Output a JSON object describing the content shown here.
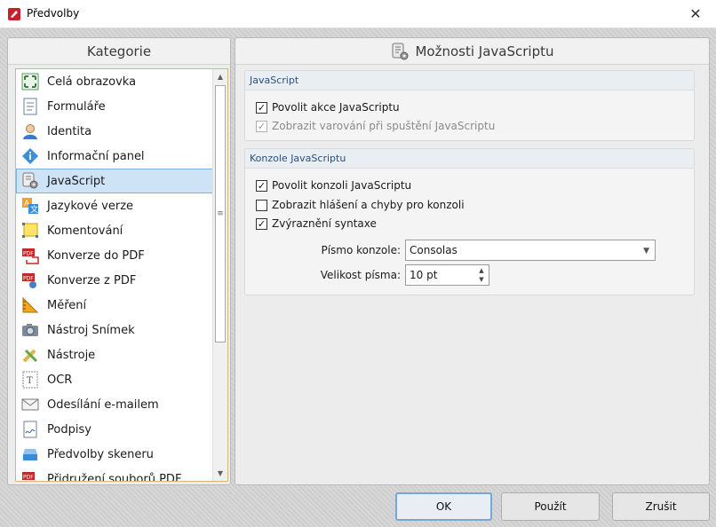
{
  "window": {
    "title": "Předvolby",
    "close_glyph": "✕"
  },
  "left_panel": {
    "header": "Kategorie",
    "items": [
      {
        "label": "Celá obrazovka",
        "icon": "fullscreen-icon"
      },
      {
        "label": "Formuláře",
        "icon": "form-icon"
      },
      {
        "label": "Identita",
        "icon": "person-icon"
      },
      {
        "label": "Informační panel",
        "icon": "info-icon"
      },
      {
        "label": "JavaScript",
        "icon": "script-gear-icon",
        "selected": true
      },
      {
        "label": "Jazykové verze",
        "icon": "language-icon"
      },
      {
        "label": "Komentování",
        "icon": "comment-icon"
      },
      {
        "label": "Konverze do PDF",
        "icon": "pdf-convert-to-icon"
      },
      {
        "label": "Konverze z PDF",
        "icon": "pdf-convert-from-icon"
      },
      {
        "label": "Měření",
        "icon": "ruler-icon"
      },
      {
        "label": "Nástroj Snímek",
        "icon": "camera-icon"
      },
      {
        "label": "Nástroje",
        "icon": "tools-icon"
      },
      {
        "label": "OCR",
        "icon": "ocr-icon"
      },
      {
        "label": "Odesílání e-mailem",
        "icon": "email-icon"
      },
      {
        "label": "Podpisy",
        "icon": "signature-icon"
      },
      {
        "label": "Předvolby skeneru",
        "icon": "scanner-icon"
      },
      {
        "label": "Přidružení souborů PDF",
        "icon": "pdf-association-icon"
      }
    ]
  },
  "right_panel": {
    "header": "Možnosti JavaScriptu",
    "group_javascript": {
      "title": "JavaScript",
      "enable_actions": {
        "label": "Povolit akce JavaScriptu",
        "checked": true
      },
      "show_warning": {
        "label": "Zobrazit varování při spuštění JavaScriptu",
        "checked": true,
        "disabled": true
      }
    },
    "group_console": {
      "title": "Konzole JavaScriptu",
      "enable_console": {
        "label": "Povolit konzoli JavaScriptu",
        "checked": true
      },
      "show_messages": {
        "label": "Zobrazit hlášení a chyby pro konzoli",
        "checked": false
      },
      "syntax_highlight": {
        "label": "Zvýraznění syntaxe",
        "checked": true
      },
      "font_label": "Písmo konzole:",
      "font_value": "Consolas",
      "size_label": "Velikost písma:",
      "size_value": "10 pt"
    }
  },
  "buttons": {
    "ok": "OK",
    "apply": "Použít",
    "cancel": "Zrušit"
  },
  "colors": {
    "selection": "#cfe3f7",
    "selection_border": "#7fb1de",
    "group_title": "#2b4f7a",
    "list_border": "#d9b779"
  }
}
